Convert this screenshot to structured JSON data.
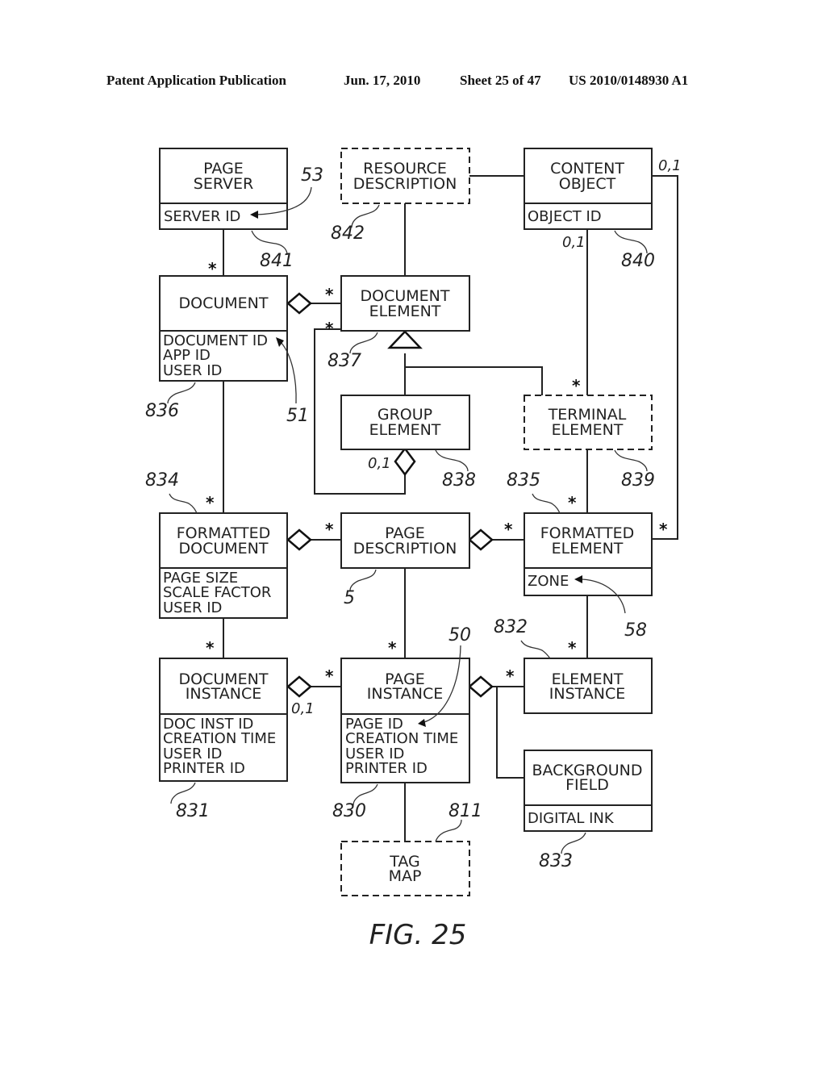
{
  "header": {
    "publication": "Patent Application Publication",
    "date": "Jun. 17, 2010",
    "sheet": "Sheet 25 of 47",
    "number": "US 2010/0148930 A1"
  },
  "figure_label": "FIG. 25",
  "classes": {
    "page_server": {
      "title": [
        "PAGE",
        "SERVER"
      ],
      "attributes": [
        "SERVER ID"
      ],
      "ref": "841",
      "style": "solid"
    },
    "resource_description": {
      "title": [
        "RESOURCE",
        "DESCRIPTION"
      ],
      "attributes": [],
      "ref": "842",
      "style": "dashed"
    },
    "content_object": {
      "title": [
        "CONTENT",
        "OBJECT"
      ],
      "attributes": [
        "OBJECT ID"
      ],
      "ref": "840",
      "style": "solid"
    },
    "document": {
      "title": [
        "DOCUMENT"
      ],
      "attributes": [
        "DOCUMENT ID",
        "APP ID",
        "USER ID"
      ],
      "ref": "836",
      "style": "solid"
    },
    "document_element": {
      "title": [
        "DOCUMENT",
        "ELEMENT"
      ],
      "attributes": [],
      "ref": "837",
      "style": "solid"
    },
    "group_element": {
      "title": [
        "GROUP",
        "ELEMENT"
      ],
      "attributes": [],
      "ref": "838",
      "style": "solid"
    },
    "terminal_element": {
      "title": [
        "TERMINAL",
        "ELEMENT"
      ],
      "attributes": [],
      "ref": "839",
      "style": "dashed"
    },
    "formatted_document": {
      "title": [
        "FORMATTED",
        "DOCUMENT"
      ],
      "attributes": [
        "PAGE SIZE",
        "SCALE FACTOR",
        "USER ID"
      ],
      "ref": "834",
      "style": "solid"
    },
    "page_description": {
      "title": [
        "PAGE",
        "DESCRIPTION"
      ],
      "attributes": [],
      "ref": "5",
      "style": "solid"
    },
    "formatted_element": {
      "title": [
        "FORMATTED",
        "ELEMENT"
      ],
      "attributes": [
        "ZONE"
      ],
      "ref": "835",
      "style": "solid"
    },
    "document_instance": {
      "title": [
        "DOCUMENT",
        "INSTANCE"
      ],
      "attributes": [
        "DOC INST ID",
        "CREATION TIME",
        "USER ID",
        "PRINTER ID"
      ],
      "ref": "831",
      "style": "solid"
    },
    "page_instance": {
      "title": [
        "PAGE",
        "INSTANCE"
      ],
      "attributes": [
        "PAGE ID",
        "CREATION TIME",
        "USER ID",
        "PRINTER ID"
      ],
      "ref": "830",
      "style": "solid"
    },
    "element_instance": {
      "title": [
        "ELEMENT",
        "INSTANCE"
      ],
      "attributes": [],
      "ref": "832",
      "style": "solid"
    },
    "background_field": {
      "title": [
        "BACKGROUND",
        "FIELD"
      ],
      "attributes": [
        "DIGITAL INK"
      ],
      "ref": "833",
      "style": "solid"
    },
    "tag_map": {
      "title": [
        "TAG",
        "MAP"
      ],
      "attributes": [],
      "ref": "811",
      "style": "dashed"
    }
  },
  "annotations": {
    "server_id_ref": "53",
    "document_id_ref": "51",
    "zone_ref": "58",
    "page_id_ref": "50"
  },
  "multiplicities": {
    "many": "*",
    "zero_or_one": "0,1"
  }
}
